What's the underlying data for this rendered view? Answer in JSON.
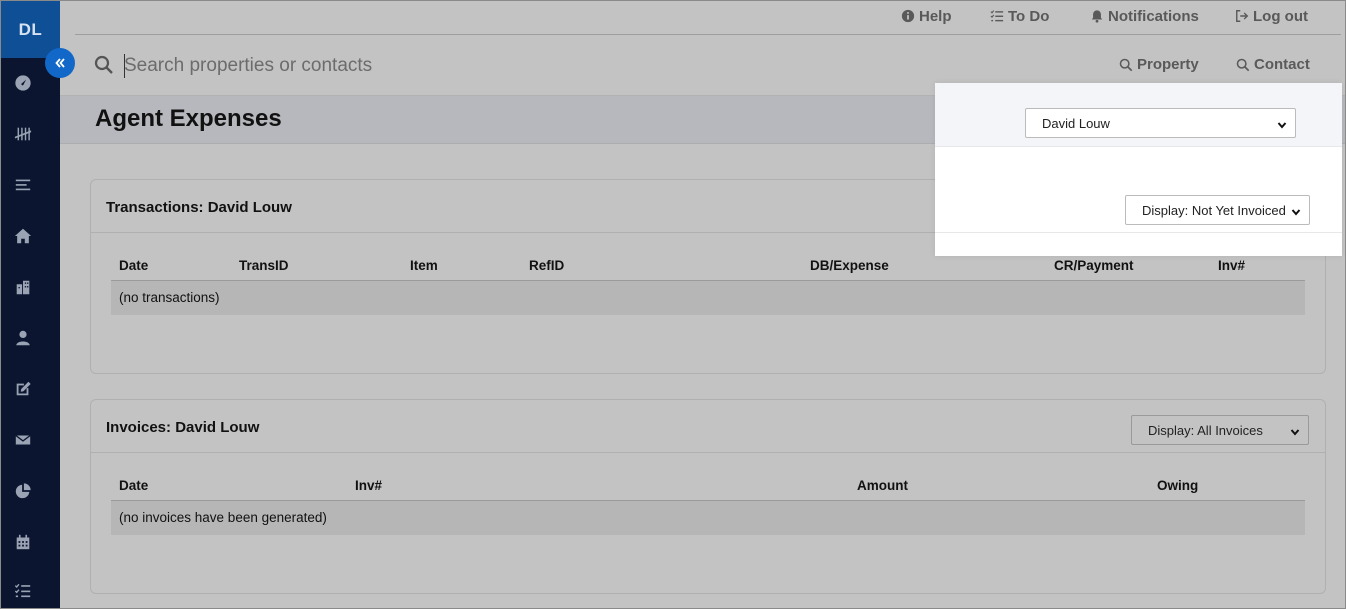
{
  "user": {
    "initials": "DL"
  },
  "topnav": {
    "help": "Help",
    "todo": "To Do",
    "notifications": "Notifications",
    "logout": "Log out"
  },
  "search": {
    "placeholder": "Search properties or contacts",
    "scope_property": "Property",
    "scope_contact": "Contact"
  },
  "page": {
    "title": "Agent Expenses",
    "agent_select": "David Louw"
  },
  "transactions": {
    "title": "Transactions: David Louw",
    "display_select": "Display: Not Yet Invoiced",
    "columns": [
      "Date",
      "TransID",
      "Item",
      "RefID",
      "DB/Expense",
      "CR/Payment",
      "Inv#"
    ],
    "empty": "(no transactions)"
  },
  "invoices": {
    "title": "Invoices: David Louw",
    "display_select": "Display: All Invoices",
    "columns": [
      "Date",
      "Inv#",
      "Amount",
      "Owing"
    ],
    "empty": "(no invoices have been generated)"
  },
  "sidebar": {
    "icons": [
      "dashboard-icon",
      "tally-icon",
      "list-icon",
      "home-icon",
      "building-icon",
      "person-icon",
      "edit-icon",
      "mail-icon",
      "pie-chart-icon",
      "calendar-icon",
      "checklist-icon"
    ]
  }
}
